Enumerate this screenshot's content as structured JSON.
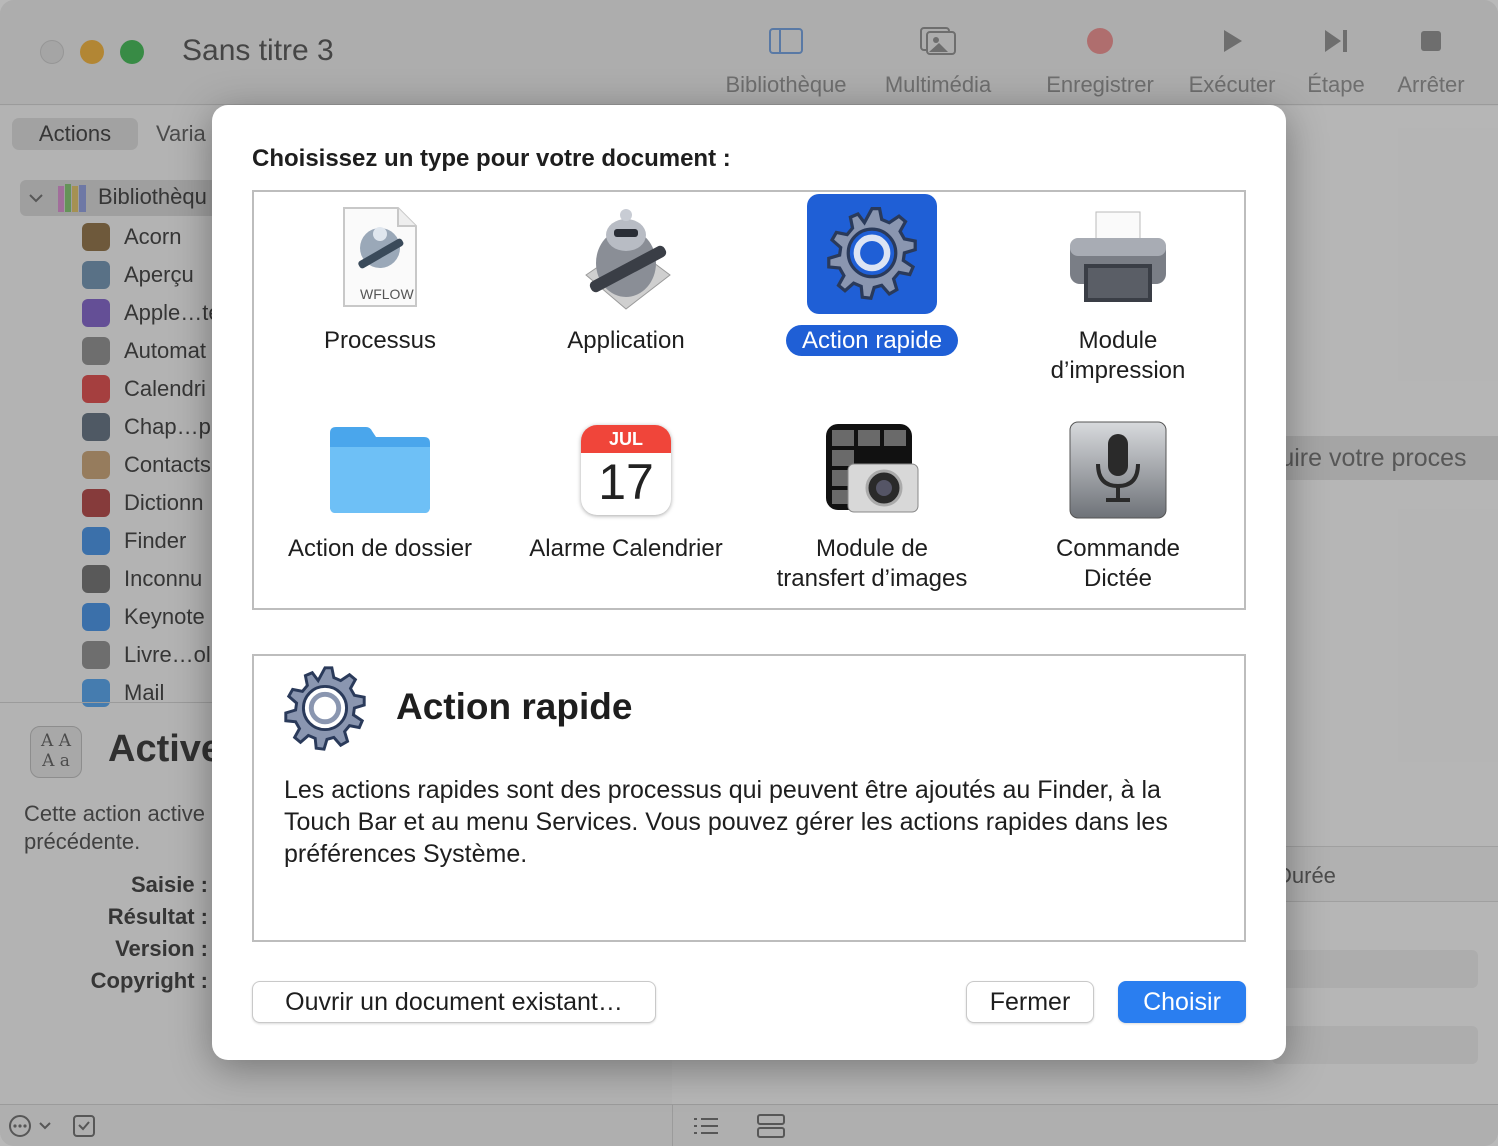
{
  "window": {
    "title": "Sans titre 3"
  },
  "toolbar": {
    "library": "Bibliothèque",
    "media": "Multimédia",
    "record": "Enregistrer",
    "run": "Exécuter",
    "step": "Étape",
    "stop": "Arrêter"
  },
  "sidebar": {
    "tabs": [
      "Actions",
      "Varia"
    ],
    "root": "Bibliothèqu",
    "items": [
      {
        "label": "Acorn",
        "icon": "acorn-icon",
        "color": "#8a6a3a"
      },
      {
        "label": "Aperçu",
        "icon": "preview-icon",
        "color": "#6a8fb0"
      },
      {
        "label": "Apple…te",
        "icon": "apple-configurator-icon",
        "color": "#7a5ac8"
      },
      {
        "label": "Automat",
        "icon": "automator-icon",
        "color": "#8a8a8a"
      },
      {
        "label": "Calendri",
        "icon": "calendar-icon",
        "color": "#e04040"
      },
      {
        "label": "Chap…pl",
        "icon": "chapter-icon",
        "color": "#5a6a7a"
      },
      {
        "label": "Contacts",
        "icon": "contacts-icon",
        "color": "#c8a070"
      },
      {
        "label": "Dictionn",
        "icon": "dictionary-icon",
        "color": "#b03a3a"
      },
      {
        "label": "Finder",
        "icon": "finder-icon",
        "color": "#3a8ee8"
      },
      {
        "label": "Inconnu",
        "icon": "unknown-tools-icon",
        "color": "#6a6a6a"
      },
      {
        "label": "Keynote",
        "icon": "keynote-icon",
        "color": "#3a8ee8"
      },
      {
        "label": "Livre…ol",
        "icon": "font-book-icon",
        "color": "#8a8a8a"
      },
      {
        "label": "Mail",
        "icon": "mail-icon",
        "color": "#4aa0f0"
      }
    ]
  },
  "info": {
    "title": "Active",
    "desc1": "Cette action active",
    "desc2": "précédente.",
    "input_label": "Saisie :",
    "result_label": "Résultat :",
    "version_label": "Version :",
    "copyright_label": "Copyright :"
  },
  "canvas": {
    "hint": "ruire votre proces",
    "duration_col": "Durée"
  },
  "dialog": {
    "prompt": "Choisissez un type pour votre document :",
    "types": [
      {
        "l1": "Processus",
        "l2": "",
        "icon": "workflow-file-icon",
        "badge": "WFLOW"
      },
      {
        "l1": "Application",
        "l2": "",
        "icon": "automator-robot-icon"
      },
      {
        "l1": "Action rapide",
        "l2": "",
        "icon": "gear-icon",
        "selected": true
      },
      {
        "l1": "Module",
        "l2": "d’impression",
        "icon": "printer-icon"
      },
      {
        "l1": "Action de dossier",
        "l2": "",
        "icon": "folder-icon"
      },
      {
        "l1": "Alarme Calendrier",
        "l2": "",
        "icon": "calendar-icon",
        "month": "JUL",
        "day": "17"
      },
      {
        "l1": "Module de",
        "l2": "transfert d’images",
        "icon": "image-capture-icon"
      },
      {
        "l1": "Commande",
        "l2": "Dictée",
        "icon": "microphone-icon"
      }
    ],
    "detail": {
      "title": "Action rapide",
      "text": "Les actions rapides sont des processus qui peuvent être ajoutés au Finder, à la Touch Bar et au menu Services. Vous pouvez gérer les actions rapides dans les préférences Système."
    },
    "buttons": {
      "open": "Ouvrir un document existant…",
      "close": "Fermer",
      "choose": "Choisir"
    }
  },
  "colors": {
    "accent": "#2a7ef0",
    "selection": "#1f5fd6"
  }
}
